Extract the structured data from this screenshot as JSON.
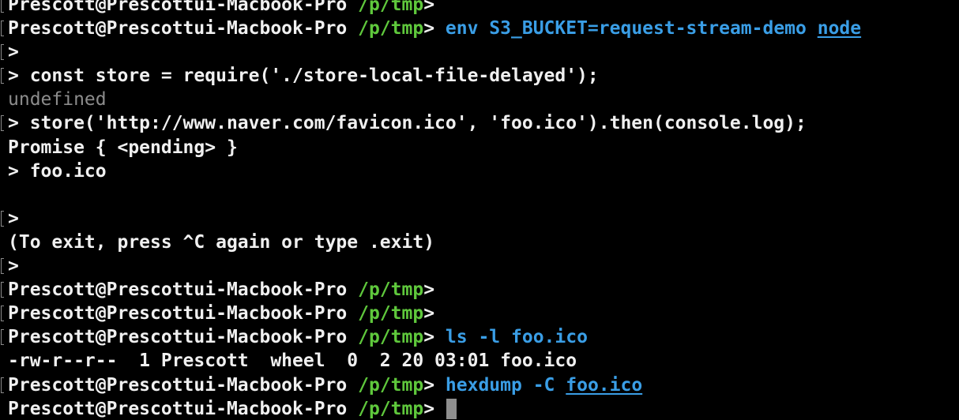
{
  "terminal": {
    "lines": [
      {
        "mark": true,
        "kind": "prompt",
        "prompt_user": "Prescott@Prescottui-Macbook-Pro",
        "prompt_dir": "/p/tmp",
        "prompt_sym": ">",
        "cmd_parts": []
      },
      {
        "mark": true,
        "kind": "prompt",
        "prompt_user": "Prescott@Prescottui-Macbook-Pro",
        "prompt_dir": "/p/tmp",
        "prompt_sym": "> ",
        "cmd_parts": [
          {
            "text": "env S3_BUCKET=request-stream-demo ",
            "style": "blue"
          },
          {
            "text": "node",
            "style": "link"
          }
        ]
      },
      {
        "mark": true,
        "kind": "text",
        "text": ">",
        "style": "plain"
      },
      {
        "mark": true,
        "kind": "text",
        "text": "> const store = require('./store-local-file-delayed');",
        "style": "plain"
      },
      {
        "mark": false,
        "kind": "text",
        "text": "undefined",
        "style": "gray"
      },
      {
        "mark": true,
        "kind": "text",
        "text": "> store('http://www.naver.com/favicon.ico', 'foo.ico').then(console.log);",
        "style": "plain"
      },
      {
        "mark": false,
        "kind": "text",
        "text": "Promise { <pending> }",
        "style": "plain"
      },
      {
        "mark": false,
        "kind": "text",
        "text": "> foo.ico",
        "style": "plain"
      },
      {
        "mark": false,
        "kind": "text",
        "text": "",
        "style": "plain"
      },
      {
        "mark": true,
        "kind": "text",
        "text": ">",
        "style": "plain"
      },
      {
        "mark": false,
        "kind": "text",
        "text": "(To exit, press ^C again or type .exit)",
        "style": "plain"
      },
      {
        "mark": true,
        "kind": "text",
        "text": ">",
        "style": "plain"
      },
      {
        "mark": true,
        "kind": "prompt",
        "prompt_user": "Prescott@Prescottui-Macbook-Pro",
        "prompt_dir": "/p/tmp",
        "prompt_sym": ">",
        "cmd_parts": []
      },
      {
        "mark": true,
        "kind": "prompt",
        "prompt_user": "Prescott@Prescottui-Macbook-Pro",
        "prompt_dir": "/p/tmp",
        "prompt_sym": ">",
        "cmd_parts": []
      },
      {
        "mark": true,
        "kind": "prompt",
        "prompt_user": "Prescott@Prescottui-Macbook-Pro",
        "prompt_dir": "/p/tmp",
        "prompt_sym": "> ",
        "cmd_parts": [
          {
            "text": "ls -l foo.ico",
            "style": "blue"
          }
        ]
      },
      {
        "mark": false,
        "kind": "text",
        "text": "-rw-r--r--  1 Prescott  wheel  0  2 20 03:01 foo.ico",
        "style": "plain"
      },
      {
        "mark": true,
        "kind": "prompt",
        "prompt_user": "Prescott@Prescottui-Macbook-Pro",
        "prompt_dir": "/p/tmp",
        "prompt_sym": "> ",
        "cmd_parts": [
          {
            "text": "hexdump -C ",
            "style": "blue"
          },
          {
            "text": "foo.ico",
            "style": "link"
          }
        ]
      },
      {
        "mark": false,
        "kind": "prompt",
        "prompt_user": "Prescott@Prescottui-Macbook-Pro",
        "prompt_dir": "/p/tmp",
        "prompt_sym": "> ",
        "cmd_parts": [],
        "cursor": true
      }
    ]
  }
}
